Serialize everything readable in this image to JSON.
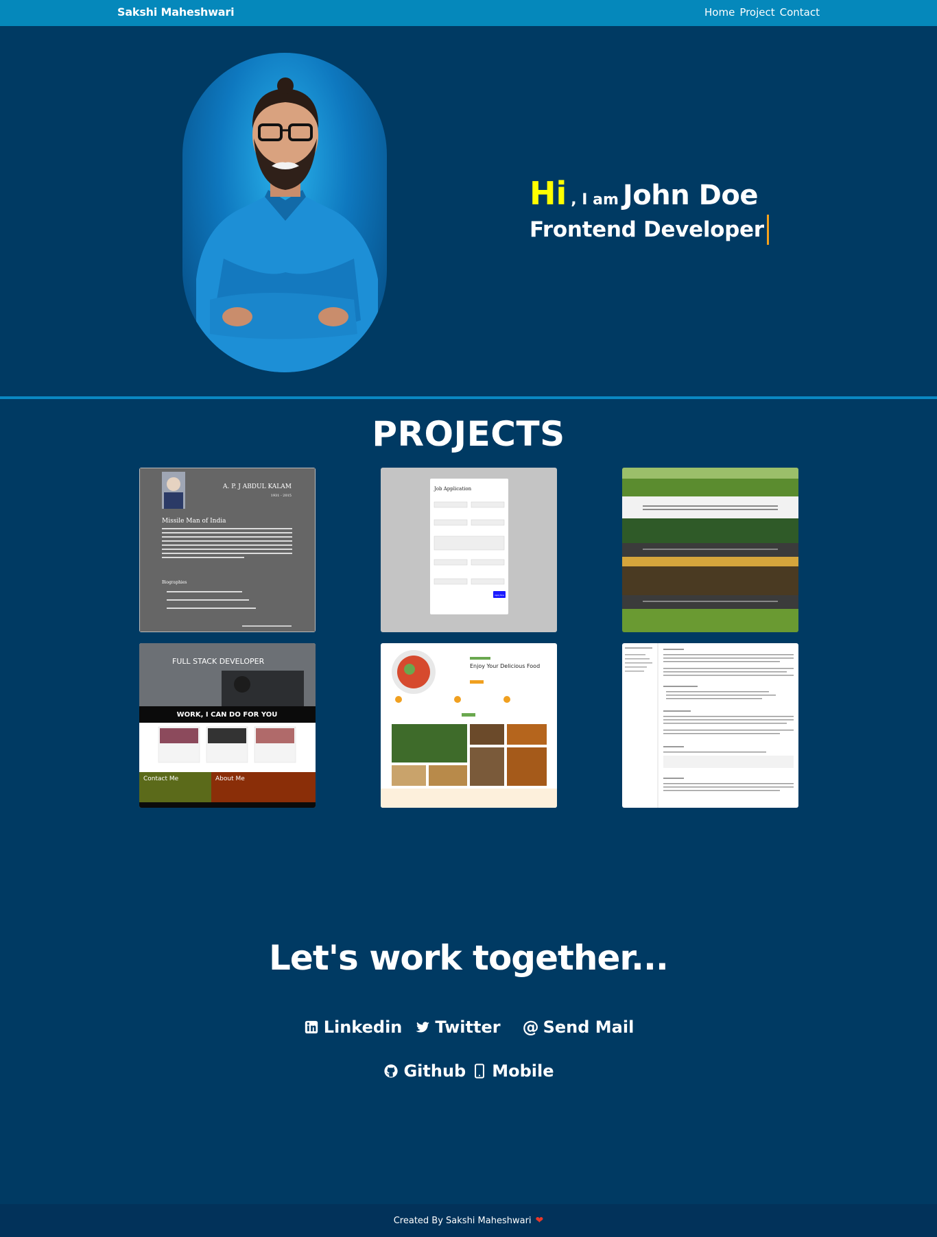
{
  "navbar": {
    "brand": "Sakshi Maheshwari",
    "links": [
      {
        "label": "Home"
      },
      {
        "label": "Project"
      },
      {
        "label": "Contact"
      }
    ]
  },
  "hero": {
    "greeting": "Hi",
    "intro": ", I am",
    "name": "John Doe",
    "role": "Frontend Developer",
    "accent_color": "#ffff00",
    "cursor_color": "#f7a21b"
  },
  "projects": {
    "title": "PROJECTS",
    "cards": [
      {
        "icon": "kalam-tribute-page-thumbnail",
        "heading": "A. P. J ABDUL KALAM",
        "subheading": "1931 - 2015",
        "tagline": "Missile Man of India",
        "section": "Biographies"
      },
      {
        "icon": "job-application-form-thumbnail",
        "heading": "Job Application",
        "button": "Apply Now"
      },
      {
        "icon": "nature-landscape-page-thumbnail"
      },
      {
        "icon": "portfolio-page-thumbnail",
        "heading": "FULL STACK DEVELOPER",
        "banner": "WORK, I CAN DO FOR YOU",
        "footer_left": "Contact Me",
        "footer_right": "About Me"
      },
      {
        "icon": "food-restaurant-page-thumbnail",
        "heading": "Enjoy Your Delicious Food"
      },
      {
        "icon": "javascript-documentation-thumbnail"
      }
    ]
  },
  "contact": {
    "title": "Let's work together...",
    "links": [
      {
        "label": "Linkedin",
        "icon": "linkedin-icon"
      },
      {
        "label": "Twitter",
        "icon": "twitter-icon"
      },
      {
        "label": "Send Mail",
        "icon": "at-icon"
      },
      {
        "label": "Github",
        "icon": "github-icon"
      },
      {
        "label": "Mobile",
        "icon": "mobile-icon"
      }
    ]
  },
  "footer": {
    "text": "Created By Sakshi Maheshwari",
    "icon": "heart-icon"
  }
}
